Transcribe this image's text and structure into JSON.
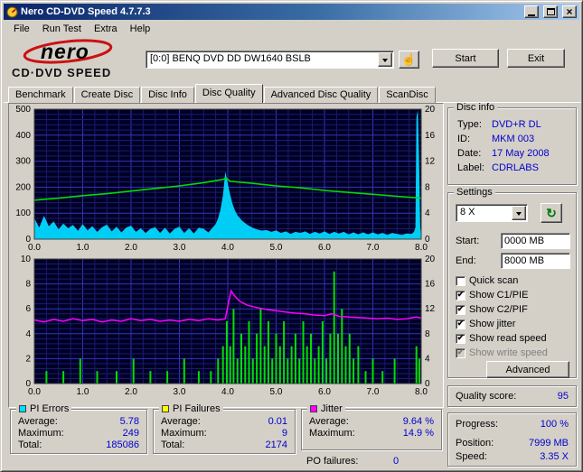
{
  "window": {
    "title": "Nero CD-DVD Speed 4.7.7.3",
    "menu": [
      "File",
      "Run Test",
      "Extra",
      "Help"
    ]
  },
  "logo": {
    "name": "nero",
    "product": "CD·DVD SPEED"
  },
  "toolbar": {
    "drive": "[0:0]   BENQ DVD DD DW1640 BSLB",
    "start_button": "Start",
    "exit_button": "Exit"
  },
  "tabs": [
    "Benchmark",
    "Create Disc",
    "Disc Info",
    "Disc Quality",
    "Advanced Disc Quality",
    "ScanDisc"
  ],
  "disc_info": {
    "title": "Disc info",
    "rows": [
      {
        "label": "Type:",
        "value": "DVD+R DL"
      },
      {
        "label": "ID:",
        "value": "MKM 003"
      },
      {
        "label": "Date:",
        "value": "17 May 2008"
      },
      {
        "label": "Label:",
        "value": "CDRLABS"
      }
    ]
  },
  "settings": {
    "title": "Settings",
    "speed": "8 X",
    "start_label": "Start:",
    "start_value": "0000 MB",
    "end_label": "End:",
    "end_value": "8000 MB",
    "checkboxes": [
      {
        "label": "Quick scan",
        "checked": false,
        "disabled": false
      },
      {
        "label": "Show C1/PIE",
        "checked": true,
        "disabled": false
      },
      {
        "label": "Show C2/PIF",
        "checked": true,
        "disabled": false
      },
      {
        "label": "Show jitter",
        "checked": true,
        "disabled": false
      },
      {
        "label": "Show read speed",
        "checked": true,
        "disabled": false
      },
      {
        "label": "Show write speed",
        "checked": true,
        "disabled": true
      }
    ],
    "advanced_button": "Advanced"
  },
  "quality": {
    "label": "Quality score:",
    "value": "95"
  },
  "progress": {
    "rows": [
      {
        "label": "Progress:",
        "value": "100 %"
      },
      {
        "label": "Position:",
        "value": "7999 MB"
      },
      {
        "label": "Speed:",
        "value": "3.35 X"
      }
    ]
  },
  "stats": {
    "pi_errors": {
      "title": "PI Errors",
      "swatch": "#00dcff",
      "rows": [
        {
          "label": "Average:",
          "value": "5.78"
        },
        {
          "label": "Maximum:",
          "value": "249"
        },
        {
          "label": "Total:",
          "value": "185086"
        }
      ]
    },
    "pi_failures": {
      "title": "PI Failures",
      "swatch": "#ffff00",
      "rows": [
        {
          "label": "Average:",
          "value": "0.01"
        },
        {
          "label": "Maximum:",
          "value": "9"
        },
        {
          "label": "Total:",
          "value": "2174"
        }
      ]
    },
    "jitter": {
      "title": "Jitter",
      "swatch": "#ff00ff",
      "rows": [
        {
          "label": "Average:",
          "value": "9.64 %"
        },
        {
          "label": "Maximum:",
          "value": "14.9 %"
        }
      ]
    },
    "po_failures": {
      "label": "PO failures:",
      "value": "0"
    }
  },
  "icons": {
    "close": "×",
    "check": "✔",
    "refresh": "↻",
    "hand": "☝"
  },
  "chart_data": [
    {
      "type": "area+line",
      "name": "PI Errors and read speed vs position (GB)",
      "x_range": [
        0,
        8
      ],
      "x_ticks": [
        "0.0",
        "1.0",
        "2.0",
        "3.0",
        "4.0",
        "5.0",
        "6.0",
        "7.0",
        "8.0"
      ],
      "left_axis": {
        "range": [
          0,
          500
        ],
        "ticks": [
          0,
          100,
          200,
          300,
          400,
          500
        ]
      },
      "right_axis": {
        "range": [
          0,
          20
        ],
        "ticks": [
          0,
          4,
          8,
          12,
          16,
          20
        ]
      },
      "colors": {
        "pi_errors": "#00d8ff",
        "read_speed": "#00dc00"
      },
      "series": {
        "pi_errors": [
          [
            0,
            80
          ],
          [
            0.1,
            45
          ],
          [
            0.2,
            90
          ],
          [
            0.3,
            50
          ],
          [
            0.4,
            68
          ],
          [
            0.5,
            38
          ],
          [
            0.6,
            60
          ],
          [
            0.7,
            42
          ],
          [
            0.8,
            55
          ],
          [
            0.9,
            32
          ],
          [
            1,
            58
          ],
          [
            1.1,
            34
          ],
          [
            1.2,
            50
          ],
          [
            1.3,
            28
          ],
          [
            1.4,
            46
          ],
          [
            1.5,
            56
          ],
          [
            1.6,
            30
          ],
          [
            1.7,
            48
          ],
          [
            1.8,
            26
          ],
          [
            1.9,
            44
          ],
          [
            2,
            52
          ],
          [
            2.1,
            28
          ],
          [
            2.2,
            42
          ],
          [
            2.3,
            24
          ],
          [
            2.4,
            40
          ],
          [
            2.5,
            46
          ],
          [
            2.6,
            24
          ],
          [
            2.7,
            44
          ],
          [
            2.8,
            22
          ],
          [
            2.9,
            40
          ],
          [
            3,
            48
          ],
          [
            3.1,
            24
          ],
          [
            3.2,
            42
          ],
          [
            3.3,
            22
          ],
          [
            3.4,
            44
          ],
          [
            3.5,
            40
          ],
          [
            3.6,
            26
          ],
          [
            3.7,
            48
          ],
          [
            3.75,
            58
          ],
          [
            3.8,
            80
          ],
          [
            3.85,
            115
          ],
          [
            3.9,
            170
          ],
          [
            3.95,
            260
          ],
          [
            4,
            215
          ],
          [
            4.05,
            170
          ],
          [
            4.1,
            135
          ],
          [
            4.15,
            110
          ],
          [
            4.2,
            92
          ],
          [
            4.3,
            70
          ],
          [
            4.4,
            56
          ],
          [
            4.5,
            45
          ],
          [
            4.6,
            38
          ],
          [
            4.7,
            33
          ],
          [
            4.8,
            35
          ],
          [
            4.9,
            28
          ],
          [
            5,
            34
          ],
          [
            5.1,
            24
          ],
          [
            5.2,
            30
          ],
          [
            5.3,
            20
          ],
          [
            5.4,
            28
          ],
          [
            5.5,
            24
          ],
          [
            5.6,
            30
          ],
          [
            5.7,
            20
          ],
          [
            5.8,
            28
          ],
          [
            5.9,
            22
          ],
          [
            6,
            30
          ],
          [
            6.1,
            20
          ],
          [
            6.2,
            28
          ],
          [
            6.3,
            22
          ],
          [
            6.4,
            28
          ],
          [
            6.5,
            18
          ],
          [
            6.6,
            26
          ],
          [
            6.7,
            18
          ],
          [
            6.8,
            26
          ],
          [
            6.9,
            18
          ],
          [
            7,
            26
          ],
          [
            7.1,
            18
          ],
          [
            7.2,
            24
          ],
          [
            7.3,
            16
          ],
          [
            7.4,
            24
          ],
          [
            7.5,
            20
          ],
          [
            7.6,
            16
          ],
          [
            7.7,
            22
          ],
          [
            7.8,
            20
          ],
          [
            7.85,
            28
          ],
          [
            7.88,
            45
          ],
          [
            7.9,
            470
          ],
          [
            7.93,
            495
          ],
          [
            7.96,
            260
          ],
          [
            7.98,
            45
          ],
          [
            8,
            15
          ]
        ],
        "read_speed": [
          [
            0,
            6.0
          ],
          [
            0.5,
            6.3
          ],
          [
            1,
            6.7
          ],
          [
            1.5,
            7.0
          ],
          [
            2,
            7.4
          ],
          [
            2.5,
            7.8
          ],
          [
            3,
            8.2
          ],
          [
            3.5,
            8.7
          ],
          [
            3.9,
            9.2
          ],
          [
            3.97,
            9.4
          ],
          [
            4.05,
            8.9
          ],
          [
            4.5,
            8.6
          ],
          [
            5,
            8.2
          ],
          [
            5.5,
            7.9
          ],
          [
            6,
            7.5
          ],
          [
            6.5,
            7.2
          ],
          [
            7,
            6.9
          ],
          [
            7.5,
            6.6
          ],
          [
            8,
            6.3
          ]
        ]
      }
    },
    {
      "type": "bars+line",
      "name": "PI Failures and jitter vs position (GB)",
      "x_range": [
        0,
        8
      ],
      "x_ticks": [
        "0.0",
        "1.0",
        "2.0",
        "3.0",
        "4.0",
        "5.0",
        "6.0",
        "7.0",
        "8.0"
      ],
      "left_axis": {
        "range": [
          0,
          10
        ],
        "ticks": [
          0,
          2,
          4,
          6,
          8,
          10
        ]
      },
      "right_axis": {
        "range": [
          0,
          20
        ],
        "ticks": [
          0,
          4,
          8,
          12,
          16,
          20
        ]
      },
      "colors": {
        "pi_failures": "#00e000",
        "jitter": "#ff00ff"
      },
      "series": {
        "pi_failures": [
          [
            0.25,
            1
          ],
          [
            0.6,
            1
          ],
          [
            0.95,
            2
          ],
          [
            1.3,
            1
          ],
          [
            1.7,
            1
          ],
          [
            2.05,
            2
          ],
          [
            2.4,
            1
          ],
          [
            2.75,
            1
          ],
          [
            3.1,
            2
          ],
          [
            3.4,
            1
          ],
          [
            3.65,
            1
          ],
          [
            3.8,
            2
          ],
          [
            3.9,
            3
          ],
          [
            3.98,
            5
          ],
          [
            4.05,
            3
          ],
          [
            4.12,
            6
          ],
          [
            4.2,
            2
          ],
          [
            4.28,
            4
          ],
          [
            4.36,
            3
          ],
          [
            4.44,
            5
          ],
          [
            4.52,
            2
          ],
          [
            4.6,
            4
          ],
          [
            4.68,
            6
          ],
          [
            4.76,
            3
          ],
          [
            4.84,
            5
          ],
          [
            4.92,
            2
          ],
          [
            5,
            4
          ],
          [
            5.08,
            3
          ],
          [
            5.16,
            5
          ],
          [
            5.24,
            2
          ],
          [
            5.32,
            3
          ],
          [
            5.4,
            4
          ],
          [
            5.48,
            2
          ],
          [
            5.56,
            5
          ],
          [
            5.64,
            3
          ],
          [
            5.72,
            4
          ],
          [
            5.8,
            2
          ],
          [
            5.88,
            3
          ],
          [
            5.96,
            5
          ],
          [
            6.04,
            2
          ],
          [
            6.12,
            4
          ],
          [
            6.2,
            9
          ],
          [
            6.28,
            4
          ],
          [
            6.36,
            6
          ],
          [
            6.44,
            3
          ],
          [
            6.52,
            4
          ],
          [
            6.6,
            2
          ],
          [
            6.7,
            3
          ],
          [
            6.85,
            1
          ],
          [
            7,
            2
          ],
          [
            7.2,
            1
          ],
          [
            7.45,
            2
          ],
          [
            7.9,
            3
          ],
          [
            7.96,
            2
          ]
        ],
        "jitter": [
          [
            0,
            10.2
          ],
          [
            0.2,
            9.9
          ],
          [
            0.4,
            10.3
          ],
          [
            0.6,
            10.0
          ],
          [
            0.8,
            10.4
          ],
          [
            1,
            10.1
          ],
          [
            1.2,
            10.3
          ],
          [
            1.4,
            9.9
          ],
          [
            1.6,
            10.2
          ],
          [
            1.8,
            10.0
          ],
          [
            2,
            10.4
          ],
          [
            2.2,
            10.1
          ],
          [
            2.4,
            10.3
          ],
          [
            2.6,
            10.0
          ],
          [
            2.8,
            10.2
          ],
          [
            3,
            10.0
          ],
          [
            3.2,
            10.3
          ],
          [
            3.4,
            10.1
          ],
          [
            3.6,
            10.4
          ],
          [
            3.8,
            10.2
          ],
          [
            3.95,
            10.4
          ],
          [
            4.02,
            13.2
          ],
          [
            4.07,
            14.9
          ],
          [
            4.15,
            14.0
          ],
          [
            4.25,
            13.2
          ],
          [
            4.4,
            12.6
          ],
          [
            4.6,
            12.2
          ],
          [
            4.8,
            11.9
          ],
          [
            5,
            11.7
          ],
          [
            5.2,
            11.5
          ],
          [
            5.4,
            11.3
          ],
          [
            5.6,
            11.2
          ],
          [
            5.8,
            11.0
          ],
          [
            6,
            10.9
          ],
          [
            6.15,
            11.2
          ],
          [
            6.3,
            10.8
          ],
          [
            6.5,
            10.7
          ],
          [
            6.7,
            10.6
          ],
          [
            6.9,
            10.5
          ],
          [
            7.1,
            10.4
          ],
          [
            7.3,
            10.5
          ],
          [
            7.5,
            10.3
          ],
          [
            7.7,
            10.4
          ],
          [
            7.9,
            10.7
          ],
          [
            8,
            10.5
          ]
        ]
      }
    }
  ]
}
